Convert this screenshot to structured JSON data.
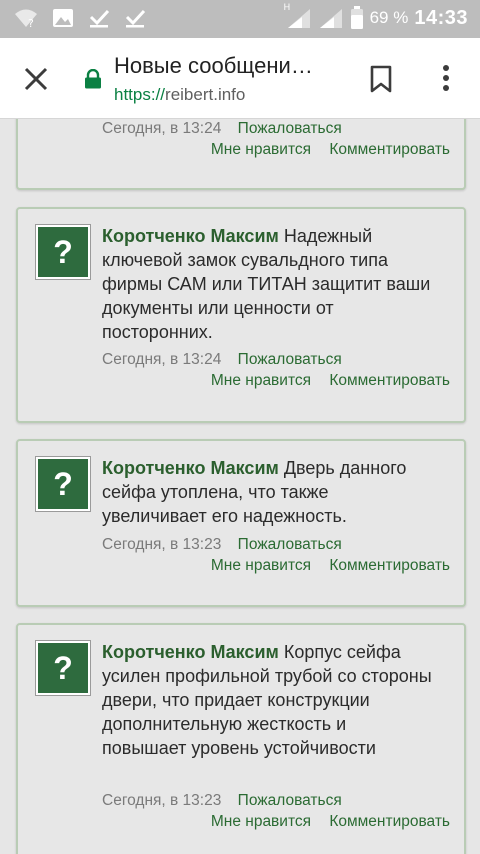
{
  "status_bar": {
    "battery_percent": "69 %",
    "time": "14:33",
    "network_label": "H"
  },
  "toolbar": {
    "title": "Новые сообщени…",
    "url_scheme": "https://",
    "url_host": "reibert.info"
  },
  "posts": [
    {
      "author": "",
      "text": "",
      "time": "Сегодня, в 13:24",
      "report": "Пожаловаться",
      "like": "Мне нравится",
      "comment": "Комментировать"
    },
    {
      "author": "Коротченко Максим",
      "text": "Надежный ключевой замок сувальдного типа фирмы САМ или ТИТАН защитит ваши документы или ценности от посторонних.",
      "time": "Сегодня, в 13:24",
      "report": "Пожаловаться",
      "like": "Мне нравится",
      "comment": "Комментировать",
      "avatar_glyph": "?"
    },
    {
      "author": "Коротченко Максим",
      "text": "Дверь данного сейфа утоплена, что также увеличивает его надежность.",
      "time": "Сегодня, в 13:23",
      "report": "Пожаловаться",
      "like": "Мне нравится",
      "comment": "Комментировать",
      "avatar_glyph": "?"
    },
    {
      "author": "Коротченко Максим",
      "text": "Корпус сейфа усилен профильной трубой со стороны двери, что придает конструкции дополнительную жесткость и повышает уровень устойчивости",
      "time": "Сегодня, в 13:23",
      "report": "Пожаловаться",
      "like": "Мне нравится",
      "comment": "Комментировать",
      "avatar_glyph": "?"
    }
  ]
}
